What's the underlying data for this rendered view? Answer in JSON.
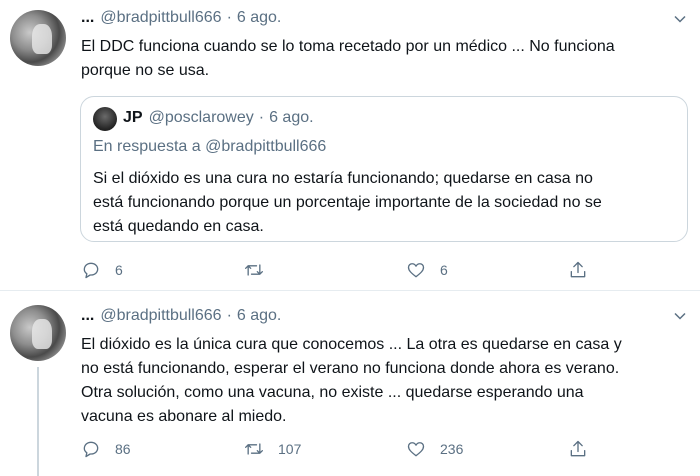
{
  "tweets": [
    {
      "name": "...",
      "handle": "@bradpittbull666",
      "date": "6 ago.",
      "text_lines": [
        "El DDC funciona cuando se lo toma recetado por un médico ... No funciona",
        "porque no se usa."
      ],
      "quote": {
        "name": "JP",
        "handle": "@posclarowey",
        "date": "6 ago.",
        "reply_prefix": "En respuesta a",
        "reply_handle": "@bradpittbull666",
        "text_lines": [
          "Si el dióxido es una cura no estaría funcionando; quedarse en casa no",
          "está funcionando porque un porcentaje importante de la sociedad no se",
          "está quedando en casa."
        ]
      },
      "replies": "6",
      "retweets": "",
      "likes": "6"
    },
    {
      "name": "...",
      "handle": "@bradpittbull666",
      "date": "6 ago.",
      "text_lines": [
        "El dióxido es la única cura que conocemos ... La otra es quedarse en casa y",
        "no está funcionando, esperar el verano no funciona donde ahora es verano.",
        "Otra solución, como una vacuna, no existe ... quedarse esperando una",
        "vacuna es abonare al miedo."
      ],
      "replies": "86",
      "retweets": "107",
      "likes": "236"
    }
  ],
  "icons": {
    "reply": "reply-icon",
    "retweet": "retweet-icon",
    "like": "heart-icon",
    "share": "share-icon",
    "more": "chevron-down-icon"
  },
  "colors": {
    "text": "#0f1419",
    "secondary": "#5b7083",
    "border": "#ccd6dd",
    "divider": "#e6ecf0"
  }
}
